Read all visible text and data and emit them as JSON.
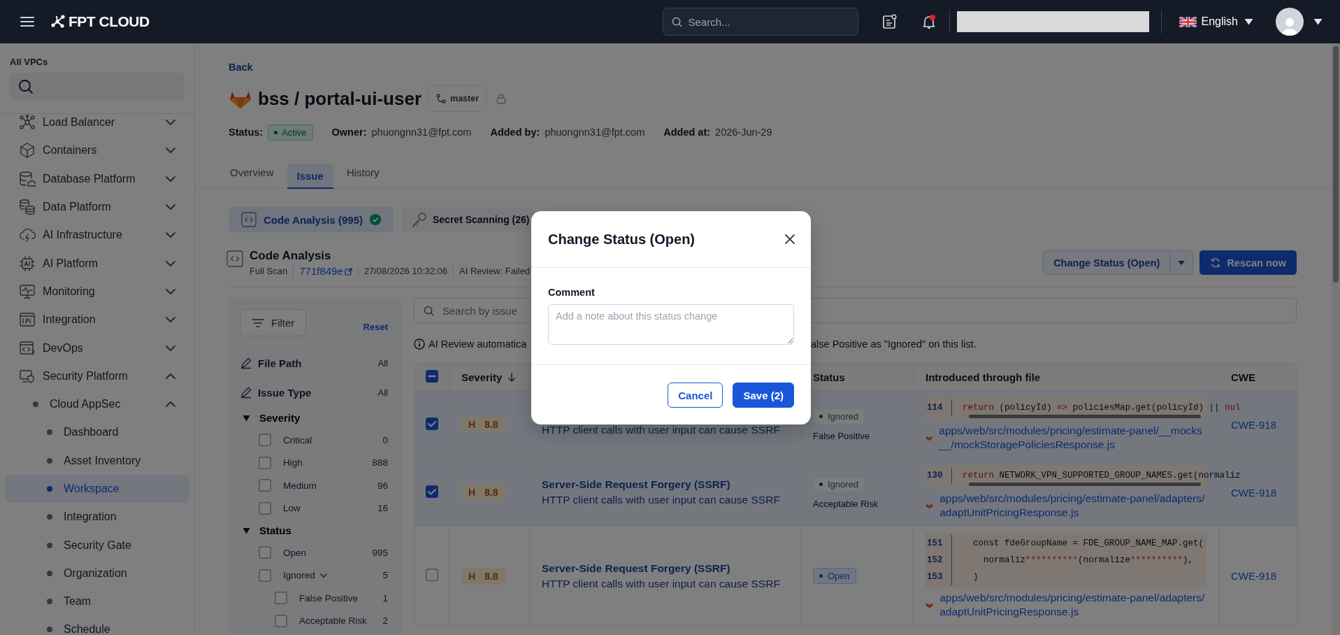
{
  "top_bar": {
    "brand": "FPT CLOUD",
    "search": {
      "placeholder": "Search..."
    },
    "language": "English"
  },
  "sidebar": {
    "vpc_label": "All VPCs",
    "items": [
      {
        "label": "Load Balancer",
        "expanded": false,
        "selected": false
      },
      {
        "label": "Containers",
        "expanded": false,
        "selected": false
      },
      {
        "label": "Database Platform",
        "expanded": false,
        "selected": false
      },
      {
        "label": "Data Platform",
        "expanded": false,
        "selected": false
      },
      {
        "label": "AI Infrastructure",
        "expanded": false,
        "selected": false
      },
      {
        "label": "AI Platform",
        "expanded": false,
        "selected": false
      },
      {
        "label": "Monitoring",
        "expanded": false,
        "selected": false
      },
      {
        "label": "Integration",
        "expanded": false,
        "selected": false
      },
      {
        "label": "DevOps",
        "expanded": false,
        "selected": false
      },
      {
        "label": "Security Platform",
        "expanded": true,
        "selected": false,
        "children": [
          {
            "label": "Cloud AppSec",
            "expanded": true,
            "selected": false,
            "children": [
              {
                "label": "Dashboard",
                "selected": false
              },
              {
                "label": "Asset Inventory",
                "selected": false
              },
              {
                "label": "Workspace",
                "selected": true
              },
              {
                "label": "Integration",
                "selected": false
              },
              {
                "label": "Security Gate",
                "selected": false
              },
              {
                "label": "Organization",
                "selected": false
              },
              {
                "label": "Team",
                "selected": false
              },
              {
                "label": "Schedule",
                "selected": false
              }
            ]
          }
        ]
      }
    ]
  },
  "page": {
    "back": "Back",
    "title": "bss / portal-ui-user",
    "branch": "master",
    "meta": [
      {
        "label": "Status:",
        "badge": "Active"
      },
      {
        "label": "Owner:",
        "value": "phuongnn31@fpt.com"
      },
      {
        "label": "Added by:",
        "value": "phuongnn31@fpt.com"
      },
      {
        "label": "Added at:",
        "value": "2026-Jun-29"
      }
    ],
    "tabs": [
      {
        "label": "Overview",
        "selected": false
      },
      {
        "label": "Issue",
        "selected": true
      },
      {
        "label": "History",
        "selected": false
      }
    ],
    "scan_tabs": [
      {
        "label": "Code Analysis (995)",
        "selected": true,
        "passed": true
      },
      {
        "label": "Secret Scanning (26)",
        "selected": false,
        "passed": false
      }
    ]
  },
  "section": {
    "title": "Code Analysis",
    "scan_type": "Full Scan",
    "commit": "771f849e",
    "scanned_at": "27/08/2026 10:32:06",
    "ai_review": "AI Review: Failed",
    "change_status": "Change Status (Open)",
    "rescan": "Rescan now"
  },
  "filter": {
    "button": "Filter",
    "reset": "Reset",
    "fields": [
      {
        "label": "File Path",
        "value": "All"
      },
      {
        "label": "Issue Type",
        "value": "All"
      }
    ],
    "groups": [
      {
        "label": "Severity",
        "expanded": true,
        "options": [
          {
            "label": "Critical",
            "count": "0",
            "checked": false
          },
          {
            "label": "High",
            "count": "888",
            "checked": false
          },
          {
            "label": "Medium",
            "count": "96",
            "checked": false
          },
          {
            "label": "Low",
            "count": "16",
            "checked": false
          }
        ]
      },
      {
        "label": "Status",
        "expanded": true,
        "options": [
          {
            "label": "Open",
            "count": "995",
            "checked": false
          },
          {
            "label": "Ignored",
            "count": "5",
            "checked": false,
            "expanded": true,
            "children": [
              {
                "label": "False Positive",
                "count": "1",
                "checked": false
              },
              {
                "label": "Acceptable Risk",
                "count": "2",
                "checked": false
              }
            ]
          }
        ]
      }
    ]
  },
  "results": {
    "search": {
      "placeholder": "Search by issue"
    },
    "info_before": "AI Review automatica",
    "info_after": "alse Positive as \"Ignored\" on this list.",
    "table": {
      "select_all": {
        "checked": true,
        "partial": true
      },
      "columns": [
        {
          "label": "Severity",
          "sorted_descending": true
        },
        {},
        {
          "label": "Status"
        },
        {
          "label": "Introduced through file"
        },
        {
          "label": "CWE"
        }
      ],
      "rows": [
        {
          "checked": true,
          "severity": {
            "grade": "H",
            "score": "8.8"
          },
          "description": "HTTP client calls with user input can cause SSRF",
          "status": {
            "label": "Ignored",
            "kind": "ignored"
          },
          "reason": "False Positive",
          "scrollable": true,
          "code": [
            {
              "number": "114",
              "tokens": [
                {
                  "text": "  return",
                  "kind": "keyword"
                },
                {
                  "text": " (policyId) ",
                  "kind": "plain"
                },
                {
                  "text": "=>",
                  "kind": "keyword"
                },
                {
                  "text": " policiesMap.get(policyId) || ",
                  "kind": "plain"
                },
                {
                  "text": "nul",
                  "kind": "keyword"
                }
              ]
            }
          ],
          "file": "apps/web/src/modules/pricing/estimate-panel/__mocks__/mockStoragePoliciesResponse.js",
          "cwe": "CWE-918"
        },
        {
          "checked": true,
          "severity": {
            "grade": "H",
            "score": "8.8"
          },
          "title": "Server-Side Request Forgery (SSRF)",
          "description": "HTTP client calls with user input can cause SSRF",
          "status": {
            "label": "Ignored",
            "kind": "ignored"
          },
          "reason": "Acceptable Risk",
          "scrollable": true,
          "code": [
            {
              "number": "130",
              "tokens": [
                {
                  "text": "  return",
                  "kind": "keyword"
                },
                {
                  "text": " NETWORK_VPN_SUPPORTED_GROUP_NAMES.get(normaliz",
                  "kind": "plain"
                }
              ]
            }
          ],
          "file": "apps/web/src/modules/pricing/estimate-panel/adapters/adaptUnitPricingResponse.js",
          "cwe": "CWE-918"
        },
        {
          "checked": false,
          "severity": {
            "grade": "H",
            "score": "8.8"
          },
          "title": "Server-Side Request Forgery (SSRF)",
          "description": "HTTP client calls with user input can cause SSRF",
          "status": {
            "label": "Open",
            "kind": "open"
          },
          "scrollable": false,
          "code": [
            {
              "number": "151",
              "tokens": [
                {
                  "text": "    const fdeGroupName = FDE_GROUP_NAME_MAP.get(",
                  "kind": "plain"
                }
              ]
            },
            {
              "number": "152",
              "tokens": [
                {
                  "text": "      normaliz",
                  "kind": "plain"
                },
                {
                  "text": "**********",
                  "kind": "masked"
                },
                {
                  "text": "(normalize",
                  "kind": "plain"
                },
                {
                  "text": "**********",
                  "kind": "masked"
                },
                {
                  "text": "),",
                  "kind": "plain"
                }
              ]
            },
            {
              "number": "153",
              "tokens": [
                {
                  "text": "    )",
                  "kind": "plain"
                }
              ]
            }
          ],
          "file": "apps/web/src/modules/pricing/estimate-panel/adapters/adaptUnitPricingResponse.js",
          "cwe": "CWE-918"
        }
      ]
    }
  },
  "modal": {
    "title": "Change Status (Open)",
    "comment_label": "Comment",
    "comment_placeholder": "Add a note about this status change",
    "cancel": "Cancel",
    "save": "Save (2)"
  }
}
